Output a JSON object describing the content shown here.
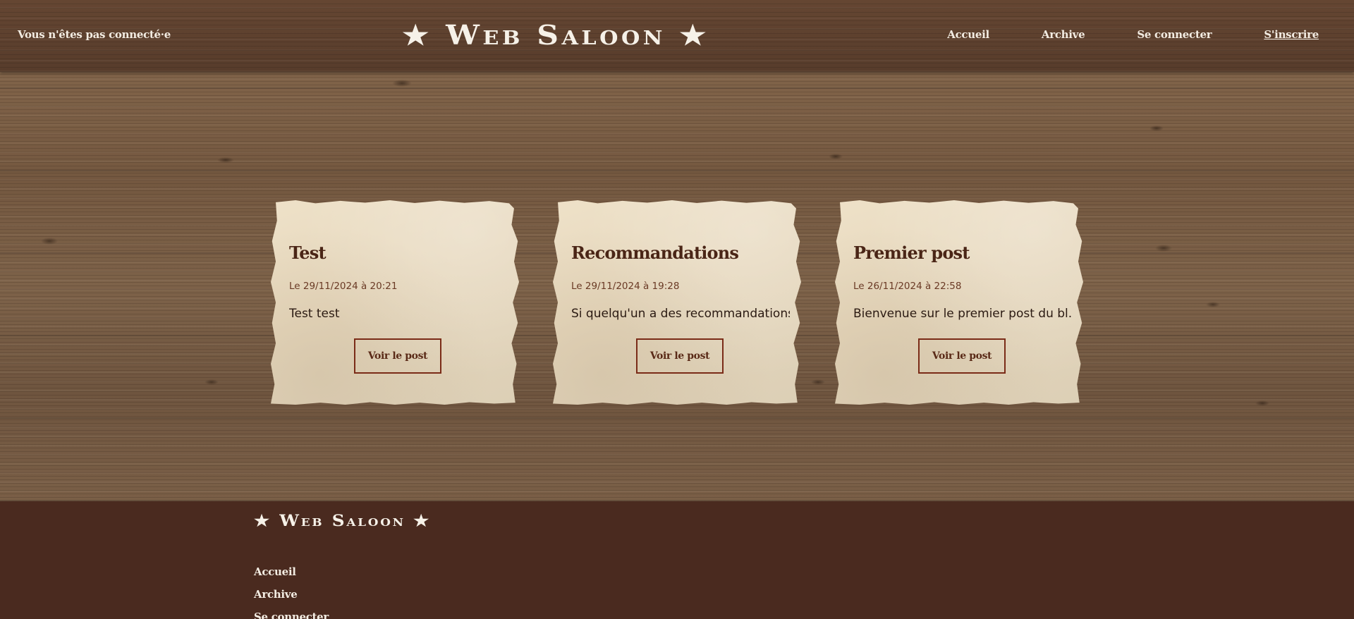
{
  "header": {
    "status": "Vous n'êtes pas connecté·e",
    "logo": "★ Web Saloon ★",
    "nav": [
      {
        "label": "Accueil"
      },
      {
        "label": "Archive"
      },
      {
        "label": "Se connecter"
      },
      {
        "label": "S'inscrire"
      }
    ]
  },
  "posts": [
    {
      "title": "Test",
      "date": "Le 29/11/2024 à 20:21",
      "excerpt": "Test test",
      "button": "Voir le post"
    },
    {
      "title": "Recommandations",
      "date": "Le 29/11/2024 à 19:28",
      "excerpt": "Si quelqu'un a des recommandations...",
      "button": "Voir le post"
    },
    {
      "title": "Premier post",
      "date": "Le 26/11/2024 à 22:58",
      "excerpt": "Bienvenue sur le premier post du bl...",
      "button": "Voir le post"
    }
  ],
  "footer": {
    "logo": "★ Web Saloon ★",
    "links": [
      {
        "label": "Accueil"
      },
      {
        "label": "Archive"
      },
      {
        "label": "Se connecter"
      }
    ]
  },
  "colors": {
    "header_bg": "#5e4231",
    "footer_bg": "#4a2a1f",
    "card_title": "#4a2516",
    "button_border": "#7a2b17"
  }
}
